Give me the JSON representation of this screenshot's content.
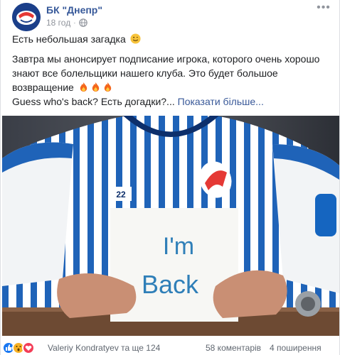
{
  "post": {
    "page_name": "БК \"Днепр\"",
    "time": "18 год",
    "separator": "·",
    "line1": "Есть небольшая загадка",
    "line2": "Завтра мы анонсирует подписание игрока, которого очень хорошо знают все болельщики нашего клуба. Это будет большое возвращение",
    "line3": "Guess who's back? Есть догадки?...",
    "see_more": "Показати більше...",
    "more_icon": "•••"
  },
  "photo": {
    "sign_line1": "I'm",
    "sign_line2": "Back",
    "jersey_number": "22"
  },
  "footer": {
    "reactors": "Valeriy Kondratyev та ще 124",
    "comments": "58 коментарів",
    "shares": "4 поширення"
  },
  "colors": {
    "link": "#365899",
    "jersey_blue": "#1f63b8",
    "sign_text": "#2f7fb8"
  },
  "icons": [
    "globe-icon",
    "smile-emoji-icon",
    "fire-emoji-icon",
    "more-options-icon",
    "like-reaction-icon",
    "wow-reaction-icon",
    "love-reaction-icon"
  ]
}
